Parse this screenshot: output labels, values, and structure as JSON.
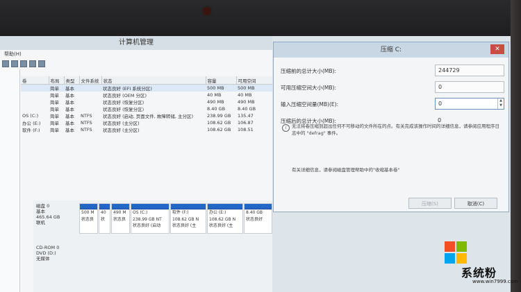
{
  "main_window": {
    "title": "计算机管理",
    "menu": "帮助(H)",
    "columns": [
      "卷",
      "布局",
      "类型",
      "文件系统",
      "状态",
      "容量",
      "可用空间"
    ],
    "volumes": [
      {
        "vol": "",
        "layout": "简单",
        "type": "基本",
        "fs": "",
        "status": "状态良好 (EFI 系统分区)",
        "capacity": "500 MB",
        "free": "500 MB"
      },
      {
        "vol": "",
        "layout": "简单",
        "type": "基本",
        "fs": "",
        "status": "状态良好 (OEM 分区)",
        "capacity": "40 MB",
        "free": "40 MB"
      },
      {
        "vol": "",
        "layout": "简单",
        "type": "基本",
        "fs": "",
        "status": "状态良好 (恢复分区)",
        "capacity": "490 MB",
        "free": "490 MB"
      },
      {
        "vol": "",
        "layout": "简单",
        "type": "基本",
        "fs": "",
        "status": "状态良好 (恢复分区)",
        "capacity": "8.40 GB",
        "free": "8.40 GB"
      },
      {
        "vol": "OS (C:)",
        "layout": "简单",
        "type": "基本",
        "fs": "NTFS",
        "status": "状态良好 (启动, 页面文件, 故障转储, 主分区)",
        "capacity": "238.99 GB",
        "free": "135.47"
      },
      {
        "vol": "办公 (E:)",
        "layout": "简单",
        "type": "基本",
        "fs": "NTFS",
        "status": "状态良好 (主分区)",
        "capacity": "108.62 GB",
        "free": "106.87"
      },
      {
        "vol": "软件 (F:)",
        "layout": "简单",
        "type": "基本",
        "fs": "NTFS",
        "status": "状态良好 (主分区)",
        "capacity": "108.62 GB",
        "free": "108.51"
      }
    ],
    "disk0": {
      "name": "磁盘 0",
      "type": "基本",
      "size": "465.64 GB",
      "state": "联机",
      "partitions": [
        {
          "name": "",
          "size": "500 M",
          "status": "状态良"
        },
        {
          "name": "",
          "size": "40",
          "status": "状"
        },
        {
          "name": "",
          "size": "490 M",
          "status": "状态良"
        },
        {
          "name": "OS (C:)",
          "size": "238.99 GB NT",
          "status": "状态良好 (启动"
        },
        {
          "name": "软件 (F:)",
          "size": "108.62 GB N",
          "status": "状态良好 (主"
        },
        {
          "name": "办公 (E:)",
          "size": "108.62 GB N",
          "status": "状态良好 (主"
        },
        {
          "name": "",
          "size": "8.40 GB",
          "status": "状态良好"
        }
      ]
    },
    "cdrom": {
      "name": "CD-ROM 0",
      "type": "DVD (D:)",
      "state": "无媒体"
    }
  },
  "shrink_dialog": {
    "title": "压缩 C:",
    "close_label": "✕",
    "fields": [
      {
        "label": "压缩前的总计大小(MB):",
        "value": "244729"
      },
      {
        "label": "可用压缩空间大小(MB):",
        "value": "0"
      },
      {
        "label": "输入压缩空间量(MB)(E):",
        "value": "0"
      },
      {
        "label": "压缩后的总计大小(MB):",
        "value": "0"
      }
    ],
    "info": "无法将卷压缩到超出任何不可移动的文件所在的点。有关完成该操作时间的详细信息，请参阅应用程序日志中的 \"defrag\" 事件。",
    "help": "有关详细信息，请参阅磁盘管理帮助中的\"收缩基本卷\"",
    "shrink_button": "压缩(S)",
    "cancel_button": "取消(C)"
  },
  "watermark": {
    "brand": "系统粉",
    "url": "www.win7999.com",
    "logo_colors": [
      "#f25022",
      "#7fba00",
      "#00a4ef",
      "#ffb900"
    ]
  }
}
